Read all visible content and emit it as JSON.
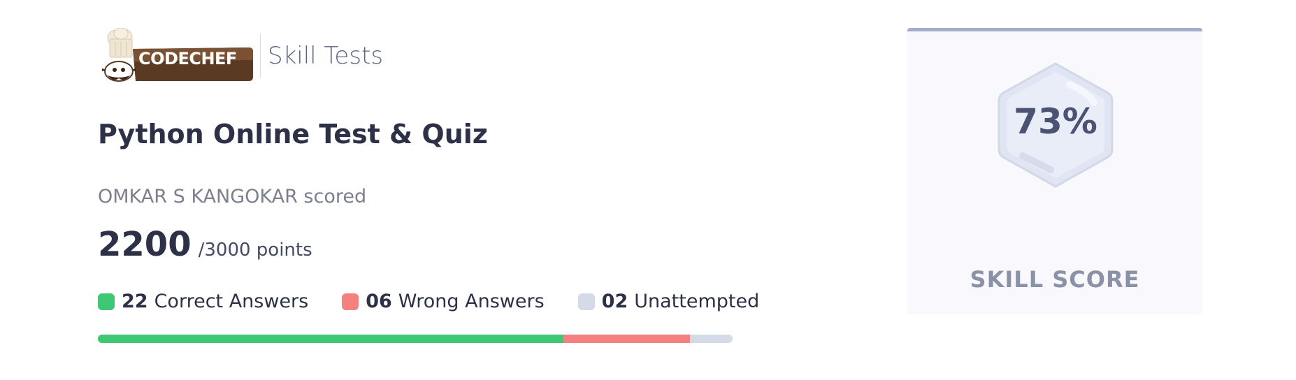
{
  "header": {
    "logo_text": "CODECHEF",
    "section_label": "Skill Tests"
  },
  "test": {
    "title": "Python Online Test & Quiz"
  },
  "result": {
    "scored_line": "OMKAR S KANGOKAR scored",
    "score": "2200",
    "total": "/3000 points"
  },
  "answers": {
    "correct": {
      "count": "22",
      "label": "Correct Answers",
      "color": "#3fc873"
    },
    "wrong": {
      "count": "06",
      "label": "Wrong Answers",
      "color": "#f48080"
    },
    "unattempted": {
      "count": "02",
      "label": "Unattempted",
      "color": "#d4dae8"
    }
  },
  "progress": {
    "correct_fraction": 0.7333,
    "wrong_fraction": 0.2,
    "unattempted_fraction": 0.0667
  },
  "skill_card": {
    "value": "73%",
    "label": "SKILL SCORE",
    "accent": "#a3acc8"
  },
  "icons": {
    "logo": "codechef-chef-hat-logo",
    "badge": "hexagon-badge-icon"
  }
}
